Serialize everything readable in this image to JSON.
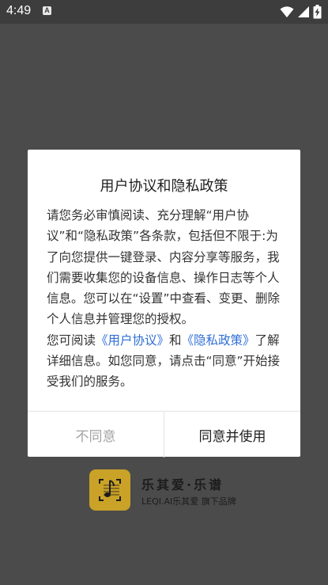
{
  "status_bar": {
    "time": "4:49",
    "notification_badge": "A",
    "icons": [
      "wifi-icon",
      "signal-icon",
      "battery-charging-icon"
    ]
  },
  "dialog": {
    "title": "用户协议和隐私政策",
    "paragraph1": "请您务必审慎阅读、充分理解“用户协议”和“隐私政策”各条款，包括但不限于:为了向您提供一键登录、内容分享等服务，我们需要收集您的设备信息、操作日志等个人信息。您可以在“设置”中查看、变更、删除个人信息并管理您的授权。",
    "p2_prefix": "您可阅读",
    "link_user_agreement": "《用户协议》",
    "p2_and": "和",
    "link_privacy_policy": "《隐私政策》",
    "p2_suffix": "了解详细信息。如您同意，请点击“同意”开始接受我们的服务。",
    "disagree_label": "不同意",
    "agree_label": "同意并使用"
  },
  "brand": {
    "name": "乐其爱·乐谱",
    "subtitle": "LEQI.AI乐其爱 旗下品牌"
  },
  "colors": {
    "overlay_bg": "#4b4b4b",
    "link": "#2f6fd6",
    "logo_gold": "#c9a227",
    "disabled_text": "#a3a3a3"
  }
}
